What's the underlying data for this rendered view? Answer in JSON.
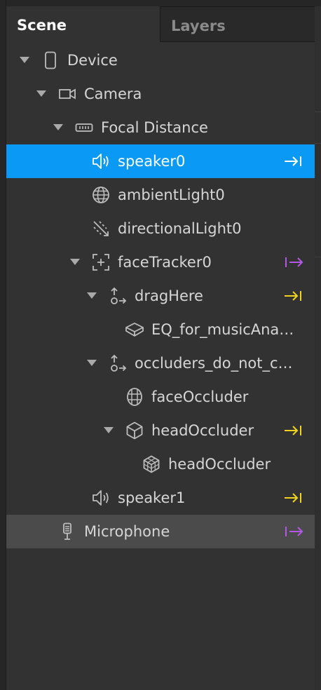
{
  "tabs": {
    "scene": "Scene",
    "layers": "Layers"
  },
  "tree": {
    "device": "Device",
    "camera": "Camera",
    "focal_distance": "Focal Distance",
    "speaker0": "speaker0",
    "ambient_light": "ambientLight0",
    "directional_light": "directionalLight0",
    "face_tracker": "faceTracker0",
    "drag_here": "dragHere",
    "eq_music": "EQ_for_musicAna…",
    "occluders": "occluders_do_not_c…",
    "face_occluder": "faceOccluder",
    "head_occluder_group": "headOccluder",
    "head_occluder_mesh": "headOccluder",
    "speaker1": "speaker1",
    "microphone": "Microphone"
  },
  "colors": {
    "selection": "#0a9af5",
    "patch_in": "#f2d21b",
    "patch_out": "#b557e6"
  }
}
